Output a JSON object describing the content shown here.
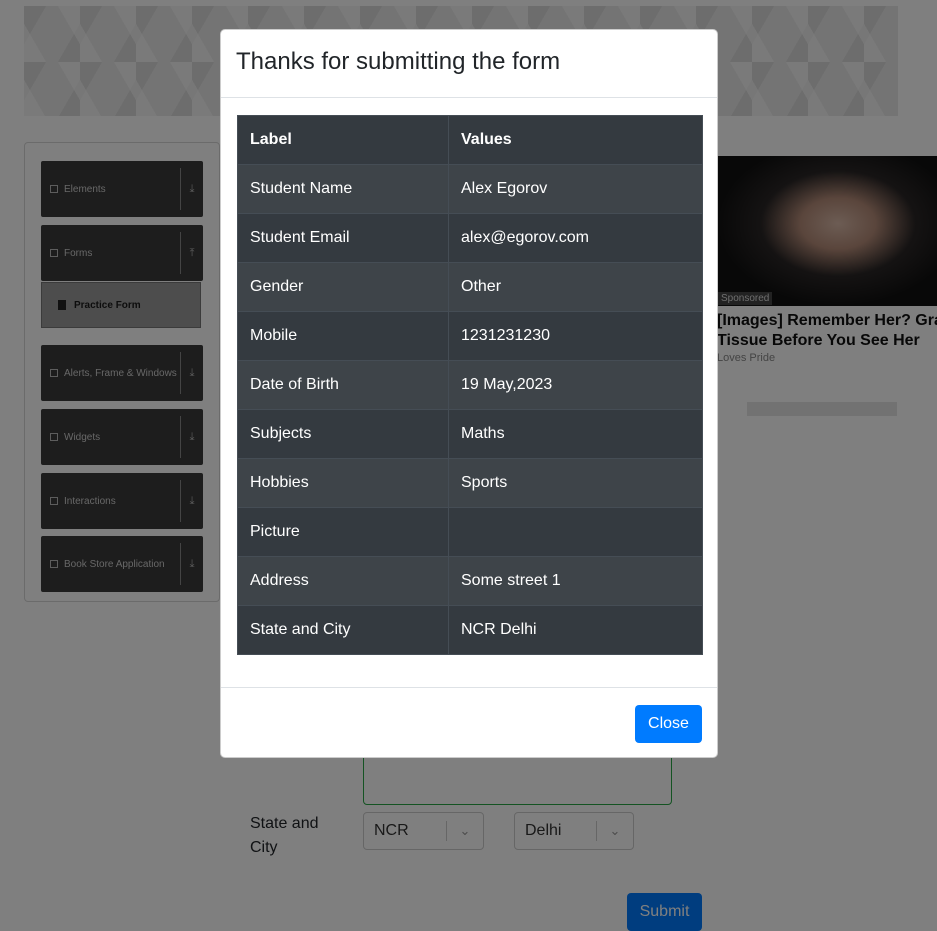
{
  "sidebar": {
    "groups": [
      {
        "label": "Elements",
        "icon": "list-icon",
        "toggle": "download-arrow-icon"
      },
      {
        "label": "Forms",
        "icon": "document-icon",
        "toggle": "upload-arrow-icon"
      },
      {
        "label": "Alerts, Frame & Windows",
        "icon": "window-icon",
        "toggle": "download-arrow-icon"
      },
      {
        "label": "Widgets",
        "icon": "grid-icon",
        "toggle": "download-arrow-icon"
      },
      {
        "label": "Interactions",
        "icon": "interaction-icon",
        "toggle": "download-arrow-icon"
      },
      {
        "label": "Book Store Application",
        "icon": "books-icon",
        "toggle": "download-arrow-icon"
      }
    ],
    "active_item": "Practice Form"
  },
  "ad": {
    "sponsored": "Sponsored",
    "title_line1": "[Images] Remember Her? Gra",
    "title_line2": "Tissue Before You See Her",
    "source": "Loves Pride"
  },
  "form": {
    "state_city_label": "State and City",
    "state_value": "NCR",
    "city_value": "Delhi",
    "submit_label": "Submit"
  },
  "modal": {
    "title": "Thanks for submitting the form",
    "headers": {
      "label": "Label",
      "values": "Values"
    },
    "rows": [
      {
        "label": "Student Name",
        "value": "Alex Egorov"
      },
      {
        "label": "Student Email",
        "value": "alex@egorov.com"
      },
      {
        "label": "Gender",
        "value": "Other"
      },
      {
        "label": "Mobile",
        "value": "1231231230"
      },
      {
        "label": "Date of Birth",
        "value": "19 May,2023"
      },
      {
        "label": "Subjects",
        "value": "Maths"
      },
      {
        "label": "Hobbies",
        "value": "Sports"
      },
      {
        "label": "Picture",
        "value": ""
      },
      {
        "label": "Address",
        "value": "Some street 1"
      },
      {
        "label": "State and City",
        "value": "NCR Delhi"
      }
    ],
    "close_label": "Close"
  },
  "colors": {
    "primary": "#007bff",
    "table_dark": "#343a40",
    "sidebar_group": "#3a3a3a"
  }
}
